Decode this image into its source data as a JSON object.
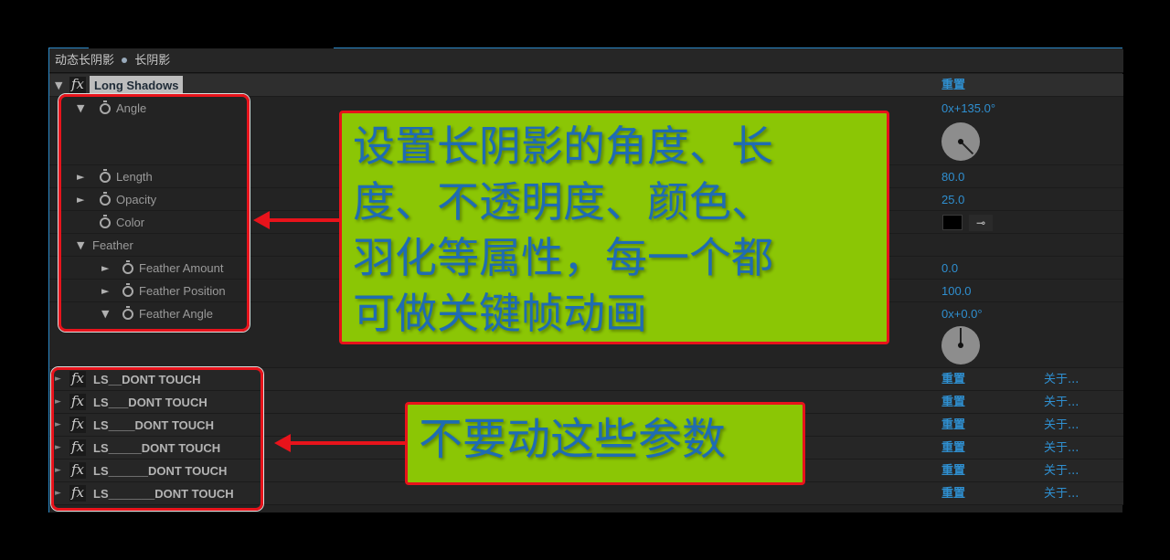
{
  "panel": {
    "header_title": "动态长阴影",
    "header_separator": "•",
    "header_layer": "长阴影"
  },
  "effect": {
    "name": "Long Shadows",
    "fx_label": "fx",
    "reset_label": "重置",
    "expanded": true
  },
  "properties": [
    {
      "label": "Angle",
      "value": "0x+135.0°",
      "expanded": true,
      "dial_degrees": 135
    },
    {
      "label": "Length",
      "value": "80.0",
      "expanded": false
    },
    {
      "label": "Opacity",
      "value": "25.0",
      "expanded": false
    },
    {
      "label": "Color",
      "value": "#000000",
      "swatch": true
    },
    {
      "label": "Feather",
      "group": true,
      "expanded": true
    },
    {
      "label": "Feather Amount",
      "value": "0.0",
      "expanded": false
    },
    {
      "label": "Feather Position",
      "value": "100.0",
      "expanded": false
    },
    {
      "label": "Feather Angle",
      "value": "0x+0.0°",
      "expanded": true,
      "dial_degrees": 0
    }
  ],
  "ls_effects": [
    {
      "name": "LS__DONT TOUCH",
      "reset_label": "重置",
      "about_label": "关于..."
    },
    {
      "name": "LS___DONT TOUCH",
      "reset_label": "重置",
      "about_label": "关于..."
    },
    {
      "name": "LS____DONT TOUCH",
      "reset_label": "重置",
      "about_label": "关于..."
    },
    {
      "name": "LS_____DONT TOUCH",
      "reset_label": "重置",
      "about_label": "关于..."
    },
    {
      "name": "LS______DONT TOUCH",
      "reset_label": "重置",
      "about_label": "关于..."
    },
    {
      "name": "LS_______DONT TOUCH",
      "reset_label": "重置",
      "about_label": "关于..."
    }
  ],
  "annotations": {
    "callout_1": "设置长阴影的角度、长度、不透明度、颜色、羽化等属性，每一个都可做关键帧动画",
    "callout_1_lines": [
      "设置长阴影的角度、长",
      "度、不透明度、颜色、",
      "羽化等属性，每一个都",
      "可做关键帧动画"
    ],
    "callout_2": "不要动这些参数"
  },
  "colors": {
    "accent_blue": "#2f8fd0",
    "callout_green": "#8bc605",
    "callout_text": "#1f6cb2",
    "highlight_red": "#e8131b"
  }
}
